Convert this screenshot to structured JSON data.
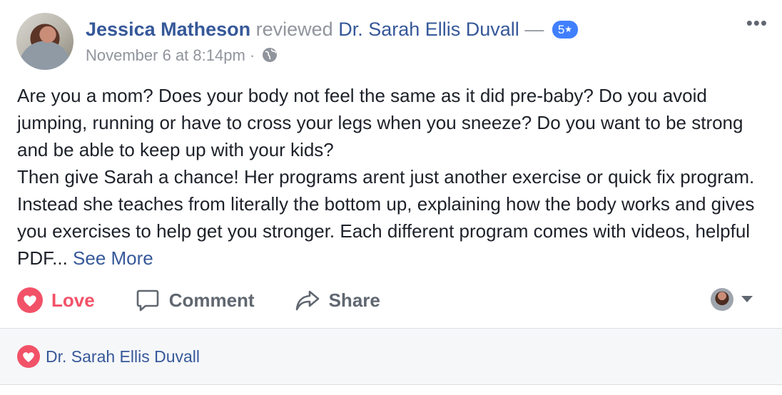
{
  "post": {
    "author": "Jessica Matheson",
    "action": "reviewed",
    "target": "Dr. Sarah Ellis Duvall",
    "dash": "—",
    "rating": "5",
    "rating_star": "★",
    "date": "November 6 at 8:14pm",
    "separator": "·",
    "more_menu": "•••",
    "body_lines": [
      "Are you a mom? Does your body not feel the same as it did pre-baby? Do you avoid jumping, running or have to cross your legs when you sneeze? Do you want to be strong and be able to keep up with your kids?",
      "Then give Sarah a chance! Her programs arent just another exercise or quick fix program. Instead she teaches from literally the bottom up, explaining how the body works and gives you exercises to help get you stronger. Each different program comes with videos, helpful PDF..."
    ],
    "see_more": "See More"
  },
  "actions": {
    "love": "Love",
    "comment": "Comment",
    "share": "Share"
  },
  "reactions": {
    "name": "Dr. Sarah Ellis Duvall"
  },
  "colors": {
    "link": "#365899",
    "love": "#f25268",
    "badge": "#4080ff",
    "muted": "#90949c"
  }
}
